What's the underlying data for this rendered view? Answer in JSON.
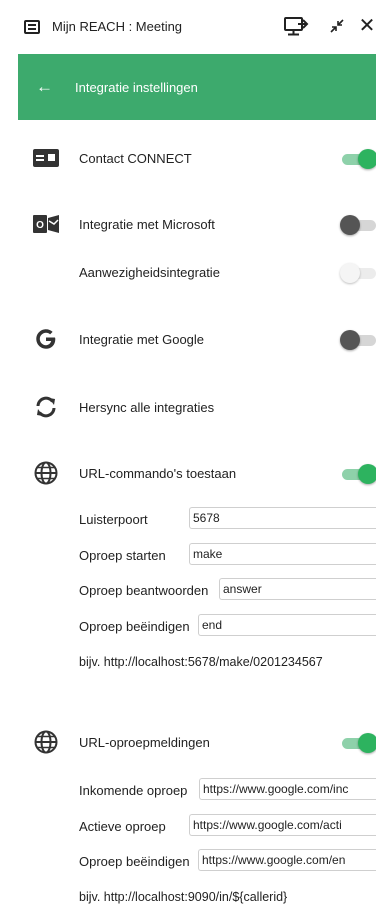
{
  "window": {
    "title": "Mijn REACH : Meeting",
    "close_glyph": "✕"
  },
  "header": {
    "back_glyph": "←",
    "title": "Integratie instellingen"
  },
  "integrations": {
    "contact_connect": {
      "label": "Contact CONNECT",
      "icon": "contact-card-icon",
      "enabled": true
    },
    "microsoft": {
      "label": "Integratie met Microsoft",
      "icon": "outlook-icon",
      "enabled": false
    },
    "presence": {
      "label": "Aanwezigheidsintegratie",
      "enabled": false,
      "disabled": true
    },
    "google": {
      "label": "Integratie met Google",
      "icon": "google-icon",
      "enabled": false
    },
    "resync": {
      "label": "Hersync alle integraties",
      "icon": "sync-icon"
    }
  },
  "url_commands": {
    "label": "URL-commando's toestaan",
    "icon": "globe-icon",
    "enabled": true,
    "fields": [
      {
        "label": "Luisterpoort",
        "value": "5678"
      },
      {
        "label": "Oproep starten",
        "value": "make"
      },
      {
        "label": "Oproep beantwoorden",
        "value": "answer"
      },
      {
        "label": "Oproep beëindigen",
        "value": "end"
      }
    ],
    "example": "bijv. http://localhost:5678/make/0201234567"
  },
  "url_notifications": {
    "label": "URL-oproepmeldingen",
    "icon": "globe-icon",
    "enabled": true,
    "fields": [
      {
        "label": "Inkomende oproep",
        "value": "https://www.google.com/inc"
      },
      {
        "label": "Actieve oproep",
        "value": "https://www.google.com/acti"
      },
      {
        "label": "Oproep beëindigen",
        "value": "https://www.google.com/en"
      }
    ],
    "example": "bijv. http://localhost:9090/in/${callerid}"
  },
  "colors": {
    "accent": "#3daa6d",
    "toggle_on": "#2db35f",
    "toggle_off": "#555555"
  }
}
